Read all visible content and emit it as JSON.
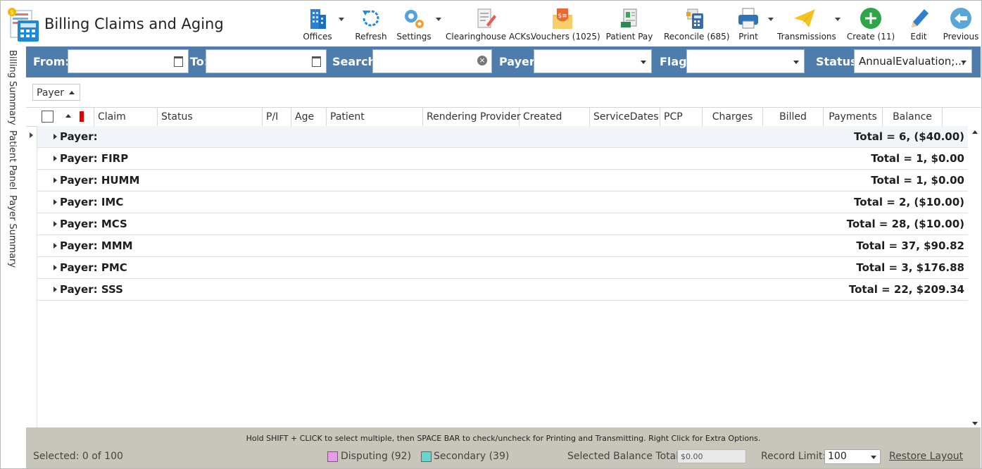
{
  "app": {
    "title": "Billing Claims and Aging"
  },
  "toolbar": [
    {
      "id": "offices",
      "label": "Offices",
      "icon": "office-buildings-icon",
      "dropdown": true
    },
    {
      "id": "refresh",
      "label": "Refresh",
      "icon": "refresh-icon",
      "dropdown": false
    },
    {
      "id": "settings",
      "label": "Settings",
      "icon": "gears-icon",
      "dropdown": true
    },
    {
      "id": "clearinghouse",
      "label": "Clearinghouse ACKs.",
      "icon": "document-edit-icon",
      "dropdown": false
    },
    {
      "id": "vouchers",
      "label": "Vouchers (1025)",
      "icon": "envelope-money-icon",
      "dropdown": false
    },
    {
      "id": "patient_pay",
      "label": "Patient Pay",
      "icon": "patient-pay-icon",
      "dropdown": false
    },
    {
      "id": "reconcile",
      "label": "Reconcile (685)",
      "icon": "calculator-icon",
      "dropdown": false
    },
    {
      "id": "print",
      "label": "Print",
      "icon": "printer-icon",
      "dropdown": true
    },
    {
      "id": "transmissions",
      "label": "Transmissions",
      "icon": "paper-plane-icon",
      "dropdown": true
    },
    {
      "id": "create",
      "label": "Create (11)",
      "icon": "plus-circle-icon",
      "dropdown": false
    },
    {
      "id": "edit",
      "label": "Edit",
      "icon": "pencil-icon",
      "dropdown": false
    },
    {
      "id": "previous",
      "label": "Previous",
      "icon": "back-arrow-icon",
      "dropdown": false
    }
  ],
  "side_tabs": [
    "Billing Summary",
    "Patient Panel",
    "Payer Summary"
  ],
  "filters": {
    "from_label": "From:",
    "from_value": "",
    "to_label": "To:",
    "to_value": "",
    "search_label": "Search:",
    "search_value": "",
    "payer_label": "Payer:",
    "payer_value": "",
    "flag_label": "Flag:",
    "flag_value": "",
    "status_label": "Status:",
    "status_value": "AnnualEvaluation;..."
  },
  "group_by": {
    "label": "Payer"
  },
  "columns": [
    "Claim",
    "Status",
    "P/I",
    "Age",
    "Patient",
    "Rendering Provider",
    "Created",
    "ServiceDates",
    "PCP",
    "Charges",
    "Billed",
    "Payments",
    "Balance"
  ],
  "groups": [
    {
      "name": "Payer:",
      "total": "Total = 6,  ($40.00)"
    },
    {
      "name": "Payer: FIRP",
      "total": "Total = 1,  $0.00"
    },
    {
      "name": "Payer: HUMM",
      "total": "Total = 1,  $0.00"
    },
    {
      "name": "Payer: IMC",
      "total": "Total = 2,  ($10.00)"
    },
    {
      "name": "Payer: MCS",
      "total": "Total = 28,  ($10.00)"
    },
    {
      "name": "Payer: MMM",
      "total": "Total = 37,  $90.82"
    },
    {
      "name": "Payer: PMC",
      "total": "Total = 3,  $176.88"
    },
    {
      "name": "Payer: SSS",
      "total": "Total = 22,  $209.34"
    }
  ],
  "footer": {
    "hint": "Hold SHIFT + CLICK to select multiple, then SPACE BAR to check/uncheck for Printing and Transmitting. Right Click for Extra Options.",
    "selected": "Selected: 0 of 100",
    "disputing": "Disputing (92)",
    "secondary": "Secondary (39)",
    "balance_label": "Selected Balance Total:",
    "balance_value": "$0.00",
    "record_limit_label": "Record Limit:",
    "record_limit_value": "100",
    "restore_layout": "Restore Layout",
    "disputing_color": "#e79be8",
    "secondary_color": "#66d6cf"
  }
}
